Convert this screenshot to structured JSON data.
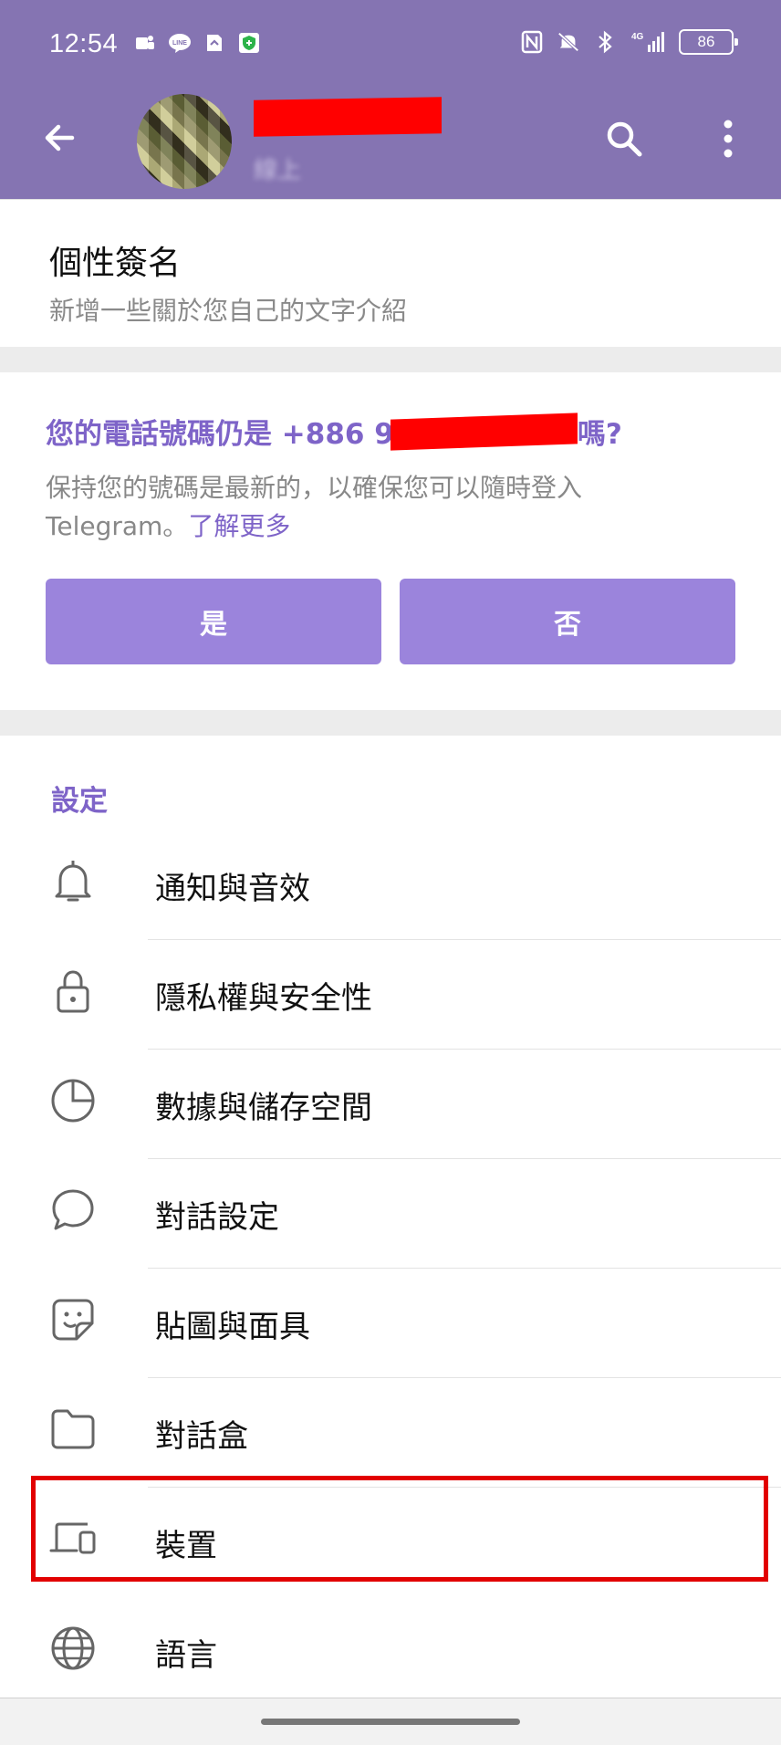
{
  "status_bar": {
    "time": "12:54",
    "battery": "86",
    "network": "4G",
    "app_icons": [
      "teams-icon",
      "line-icon",
      "notification-icon",
      "shield-icon"
    ],
    "system_icons": [
      "nfc-icon",
      "mute-icon",
      "bluetooth-icon",
      "signal-icon"
    ]
  },
  "app_bar": {
    "status_text": "線上"
  },
  "bio": {
    "title": "個性簽名",
    "subtitle": "新增一些關於您自己的文字介紹"
  },
  "phone_prompt": {
    "question_prefix": "您的電話號碼仍是 +886 9",
    "question_suffix": "嗎?",
    "description": "保持您的號碼是最新的，以確保您可以隨時登入 Telegram。",
    "link": "了解更多",
    "yes_label": "是",
    "no_label": "否"
  },
  "settings": {
    "section_title": "設定",
    "items": [
      {
        "label": "通知與音效",
        "icon": "bell-icon"
      },
      {
        "label": "隱私權與安全性",
        "icon": "lock-icon"
      },
      {
        "label": "數據與儲存空間",
        "icon": "pie-chart-icon"
      },
      {
        "label": "對話設定",
        "icon": "chat-bubble-icon"
      },
      {
        "label": "貼圖與面具",
        "icon": "sticker-icon"
      },
      {
        "label": "對話盒",
        "icon": "folder-icon"
      },
      {
        "label": "裝置",
        "icon": "devices-icon"
      },
      {
        "label": "語言",
        "icon": "globe-icon"
      }
    ]
  },
  "colors": {
    "app_bar": "#8574b2",
    "accent": "#7e64c8",
    "button": "#9b84dc",
    "highlight": "#e20000",
    "redaction": "#ff0000"
  }
}
